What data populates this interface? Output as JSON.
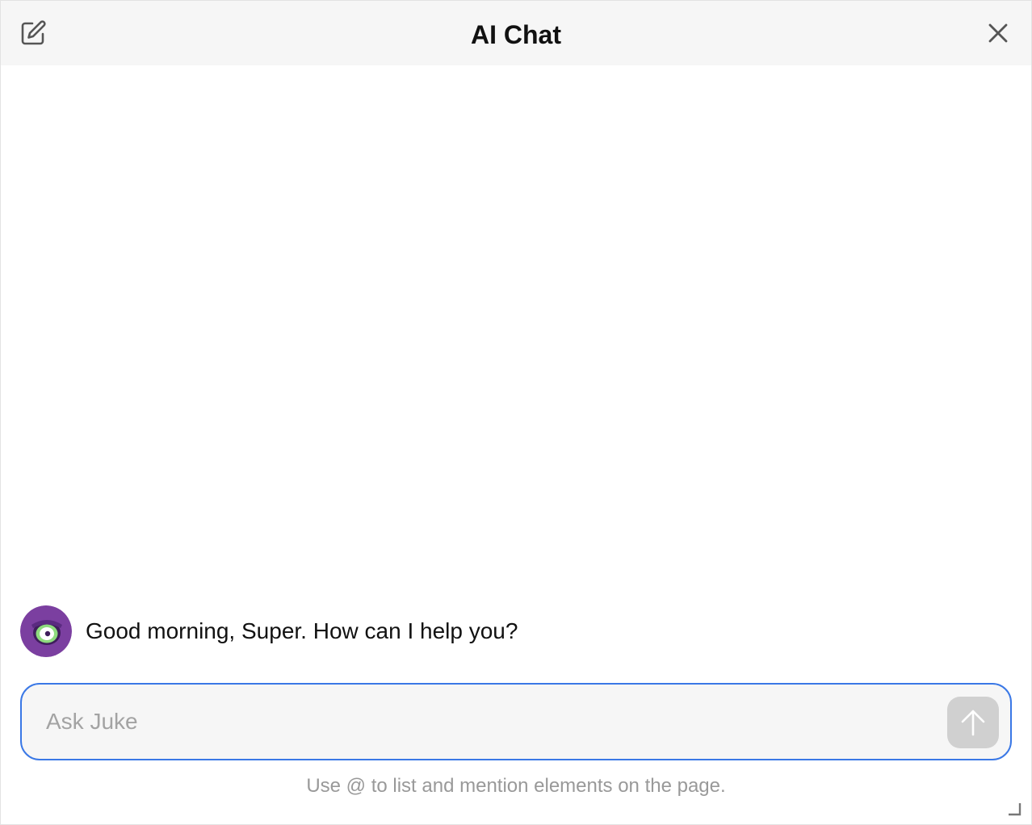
{
  "header": {
    "title": "AI Chat",
    "new_chat_icon": "edit-icon",
    "close_icon": "close-icon"
  },
  "messages": [
    {
      "sender": "assistant",
      "avatar_icon": "cyclops-avatar",
      "text": "Good morning, Super. How can I help you?"
    }
  ],
  "composer": {
    "placeholder": "Ask Juke",
    "value": "",
    "send_icon": "arrow-up-icon",
    "hint": "Use @ to list and mention elements on the page."
  },
  "colors": {
    "header_bg": "#f6f6f6",
    "input_border": "#3a78e6",
    "input_bg": "#f6f6f6",
    "send_button_bg": "#d0d0d0",
    "avatar_purple": "#7b3fa0",
    "avatar_eye_green": "#8edb7e"
  }
}
